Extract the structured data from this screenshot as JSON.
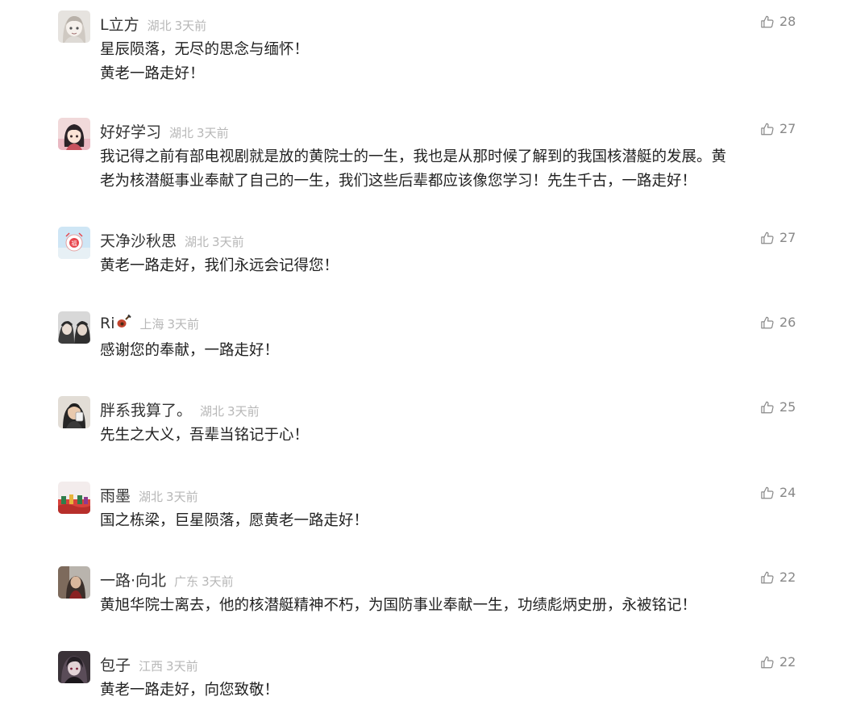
{
  "comments": [
    {
      "username": "L立方",
      "location": "湖北",
      "time": "3天前",
      "lines": [
        "星辰陨落，无尽的思念与缅怀！",
        "黄老一路走好！"
      ],
      "likes": "28"
    },
    {
      "username": "好好学习",
      "location": "湖北",
      "time": "3天前",
      "lines": [
        "我记得之前有部电视剧就是放的黄院士的一生，我也是从那时候了解到的我国核潜艇的发展。黄",
        "老为核潜艇事业奉献了自己的一生，我们这些后辈都应该像您学习！先生千古，一路走好！"
      ],
      "likes": "27"
    },
    {
      "username": "天净沙秋思",
      "location": "湖北",
      "time": "3天前",
      "lines": [
        "黄老一路走好，我们永远会记得您！"
      ],
      "likes": "27"
    },
    {
      "username": "Ri",
      "username_emoji": "guitar-emoji",
      "location": "上海",
      "time": "3天前",
      "lines": [
        "感谢您的奉献，一路走好！"
      ],
      "likes": "26"
    },
    {
      "username": "胖系我算了。",
      "location": "湖北",
      "time": "3天前",
      "lines": [
        "先生之大义，吾辈当铭记于心！"
      ],
      "likes": "25"
    },
    {
      "username": "雨墨",
      "location": "湖北",
      "time": "3天前",
      "lines": [
        "国之栋梁，巨星陨落，愿黄老一路走好！"
      ],
      "likes": "24"
    },
    {
      "username": "一路·向北",
      "location": "广东",
      "time": "3天前",
      "lines": [
        "黄旭华院士离去，他的核潜艇精神不朽，为国防事业奉献一生，功绩彪炳史册，永被铭记！"
      ],
      "likes": "22"
    },
    {
      "username": "包子",
      "location": "江西",
      "time": "3天前",
      "lines": [
        "黄老一路走好，向您致敬！"
      ],
      "likes": "22"
    }
  ],
  "icons": {
    "like": "thumbs-up-icon"
  },
  "colors": {
    "username": "#333333",
    "meta": "#b7b7b7",
    "text": "#222222",
    "like": "#888888"
  }
}
